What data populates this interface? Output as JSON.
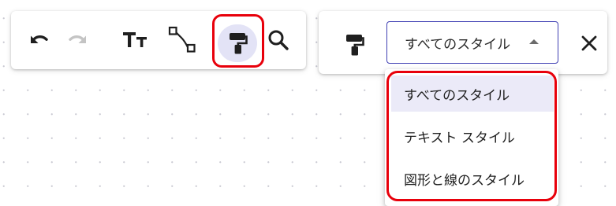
{
  "main_toolbar": {
    "icons": [
      "undo-icon",
      "redo-icon",
      "text-style-icon",
      "connector-icon",
      "paint-format-icon",
      "search-icon"
    ],
    "active_tool": "paint-format-icon",
    "disabled_tools": [
      "redo-icon"
    ]
  },
  "format_toolbar": {
    "paint_icon": "paint-format-icon",
    "style_select": {
      "selected": "すべてのスタイル",
      "expanded": true
    },
    "close_icon": "close-icon"
  },
  "style_dropdown": {
    "items": [
      {
        "label": "すべてのスタイル",
        "selected": true
      },
      {
        "label": "テキスト スタイル",
        "selected": false
      },
      {
        "label": "図形と線のスタイル",
        "selected": false
      }
    ]
  },
  "colors": {
    "accent": "#3f3fb3",
    "active_tool_bg": "#e3e3f6",
    "selected_item_bg": "#ebeaf8",
    "highlight": "#e8000b",
    "disabled_icon": "#c4c4c4",
    "icon": "#1f1f1f"
  }
}
